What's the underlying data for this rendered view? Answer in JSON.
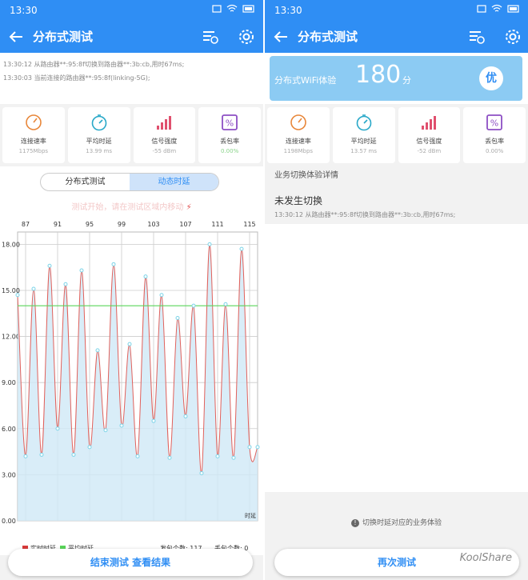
{
  "status_bar": {
    "time": "13:30"
  },
  "left": {
    "title": "分布式测试",
    "log_lines": [
      "13:30:12 从路由器**:95:8f切换到路由器**:3b:cb,用时67ms;",
      "13:30:03 当前连接的路由器**:95:8f(linking-5G);"
    ],
    "metrics": [
      {
        "icon": "speedometer-icon",
        "label": "连接速率",
        "value": "1175Mbps"
      },
      {
        "icon": "latency-gauge-icon",
        "label": "平均时延",
        "value": "13.99 ms"
      },
      {
        "icon": "signal-bars-icon",
        "label": "信号强度",
        "value": "-55 dBm"
      },
      {
        "icon": "packet-loss-icon",
        "label": "丢包率",
        "value": "0.00%"
      }
    ],
    "tabs": [
      {
        "label": "分布式测试",
        "active": false
      },
      {
        "label": "动态时延",
        "active": true
      }
    ],
    "hint": "测试开始，请在测试区域内移动",
    "legend": {
      "realtime": "实时时延",
      "average": "平均时延",
      "sent_label": "发包个数: 117",
      "lost_label": "丢包个数: 0"
    },
    "bottom_button": "结束测试  查看结果"
  },
  "right": {
    "title": "分布式测试",
    "score_label": "分布式WiFi体验",
    "score_value": "180",
    "score_unit": "分",
    "grade": "优",
    "metrics": [
      {
        "icon": "speedometer-icon",
        "label": "连接速率",
        "value": "1198Mbps"
      },
      {
        "icon": "latency-gauge-icon",
        "label": "平均时延",
        "value": "13.57 ms"
      },
      {
        "icon": "signal-bars-icon",
        "label": "信号强度",
        "value": "-52 dBm"
      },
      {
        "icon": "packet-loss-icon",
        "label": "丢包率",
        "value": "0.00%"
      }
    ],
    "detail_header": "业务切换体验详情",
    "detail_title": "未发生切换",
    "detail_line": "13:30:12 从路由器**:95:8f切换到路由器**:3b:cb,用时67ms;",
    "footnote": "切换时延对应的业务体验",
    "bottom_button": "再次测试",
    "watermark": "KoolShare"
  },
  "colors": {
    "primary": "#2f8ef4",
    "realtime": "#e0615c",
    "average": "#5ad55a",
    "fill": "#cfe8f6"
  },
  "chart_data": {
    "type": "line",
    "x_ticks": [
      87,
      91,
      95,
      99,
      103,
      107,
      111,
      115
    ],
    "y_ticks": [
      "18.00",
      "15.00",
      "12.00",
      "9.00",
      "6.00",
      "3.00",
      "0.00"
    ],
    "ylim": [
      0,
      18.8
    ],
    "xlim": [
      86,
      116
    ],
    "xlabel": "时延",
    "average": 14.0,
    "series": [
      {
        "name": "实时时延",
        "x": [
          86,
          87,
          88,
          89,
          90,
          91,
          92,
          93,
          94,
          95,
          96,
          97,
          98,
          99,
          100,
          101,
          102,
          103,
          104,
          105,
          106,
          107,
          108,
          109,
          110,
          111,
          112,
          113,
          114,
          115,
          116
        ],
        "values": [
          14.7,
          4.2,
          15.1,
          4.3,
          16.6,
          6.0,
          15.4,
          4.3,
          16.3,
          4.8,
          11.1,
          5.9,
          16.7,
          6.2,
          11.5,
          4.2,
          15.9,
          6.5,
          14.7,
          4.1,
          13.2,
          6.8,
          14.0,
          3.1,
          18.0,
          4.2,
          14.1,
          4.1,
          17.7,
          4.8,
          4.8
        ]
      }
    ]
  }
}
